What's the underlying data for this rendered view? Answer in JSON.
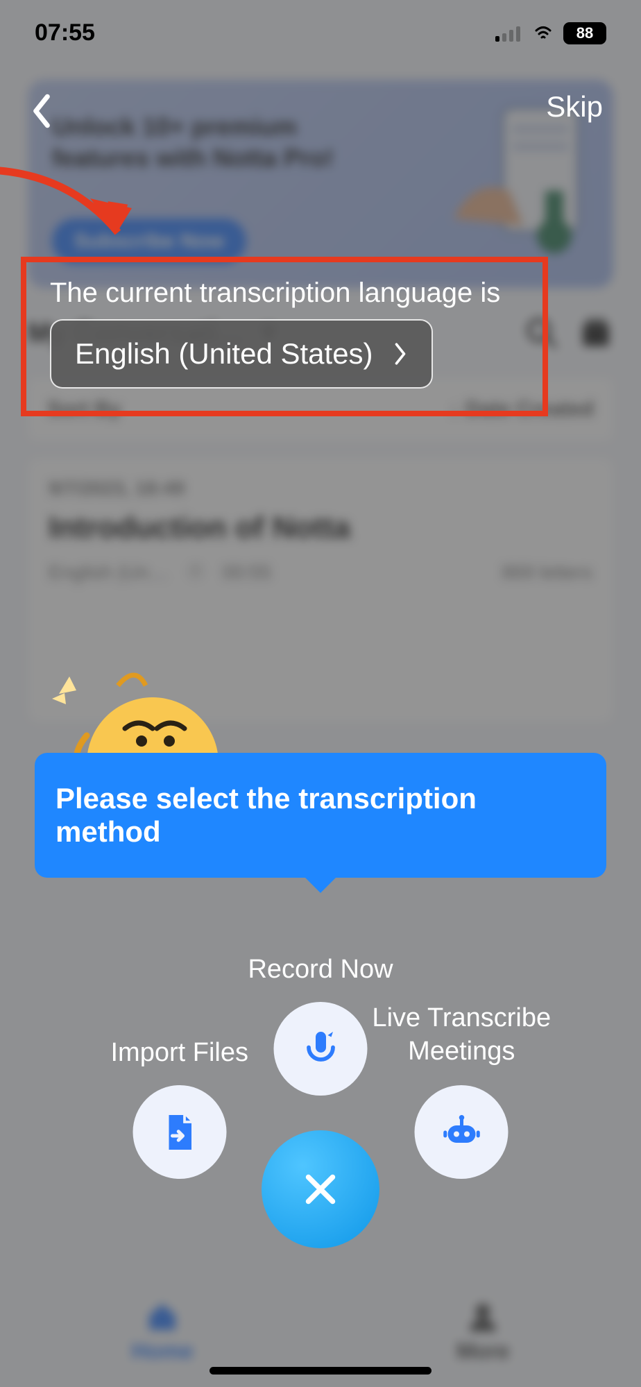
{
  "status": {
    "time": "07:55",
    "battery": "88"
  },
  "nav": {
    "skip": "Skip"
  },
  "banner": {
    "line1": "Unlock 10+ premium",
    "line2": "features with Notta Pro!",
    "cta": "Subscribe Now"
  },
  "main": {
    "section_title": "My Conversati…",
    "sort_label": "Sort By",
    "sort_value": "↓ Date Created"
  },
  "card": {
    "date": "9/7/2023, 18:49",
    "title": "Introduction of Notta",
    "meta_lang": "English (Un…",
    "meta_dur": "00:55",
    "meta_right": "869 letters"
  },
  "language": {
    "heading": "The current transcription language is",
    "value": "English (United States)"
  },
  "tooltip": {
    "text": "Please select the transcription method"
  },
  "radial": {
    "record": "Record Now",
    "import": "Import Files",
    "live_l1": "Live Transcribe",
    "live_l2": "Meetings"
  },
  "tabs": {
    "home": "Home",
    "more": "More"
  }
}
